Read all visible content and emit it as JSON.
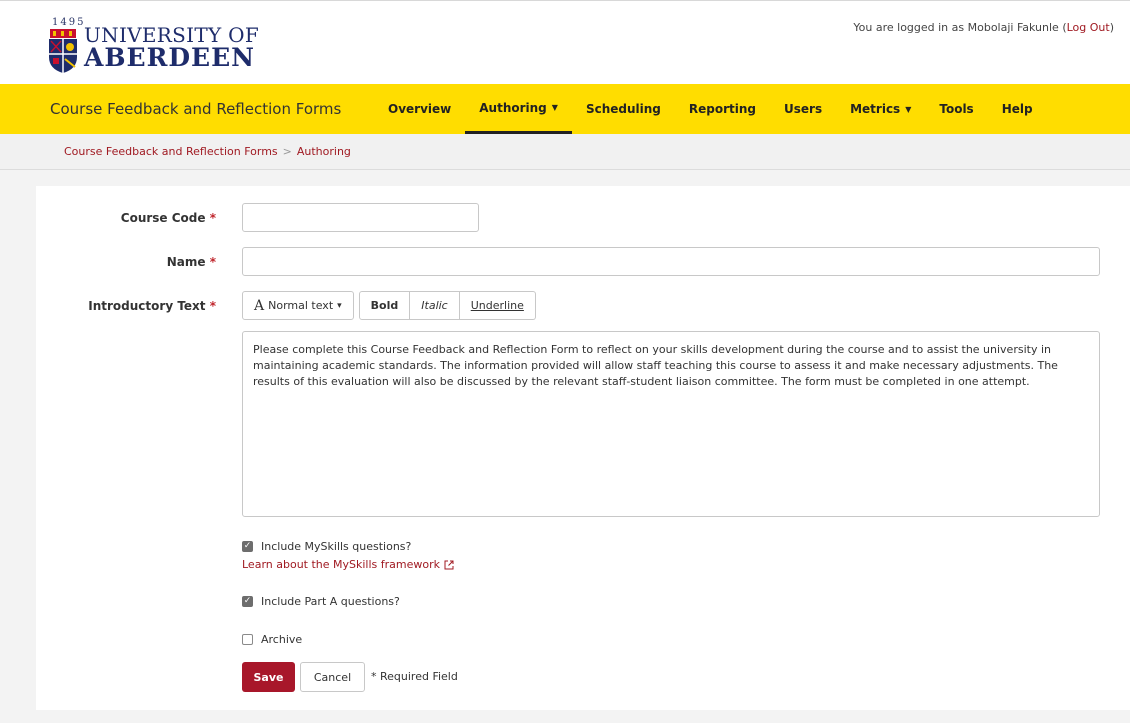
{
  "header": {
    "logo": {
      "year": "1495",
      "line1": "UNIVERSITY OF",
      "line2": "ABERDEEN"
    },
    "login_text": "You are logged in as Mobolaji Fakunle (",
    "logout_label": "Log Out",
    "login_close": ")"
  },
  "navbar": {
    "brand": "Course Feedback and Reflection Forms",
    "items": [
      {
        "label": "Overview",
        "dropdown": false
      },
      {
        "label": "Authoring",
        "dropdown": true,
        "active": true
      },
      {
        "label": "Scheduling",
        "dropdown": false
      },
      {
        "label": "Reporting",
        "dropdown": false
      },
      {
        "label": "Users",
        "dropdown": false
      },
      {
        "label": "Metrics",
        "dropdown": true
      },
      {
        "label": "Tools",
        "dropdown": false
      },
      {
        "label": "Help",
        "dropdown": false
      }
    ],
    "caret": "▼"
  },
  "breadcrumb": {
    "items": [
      "Course Feedback and Reflection Forms",
      "Authoring"
    ],
    "separator": ">"
  },
  "form": {
    "required_mark": "*",
    "course_code": {
      "label": "Course Code",
      "value": ""
    },
    "name": {
      "label": "Name",
      "value": ""
    },
    "intro": {
      "label": "Introductory Text",
      "toolbar": {
        "style_glyph": "A",
        "style_label": "Normal text",
        "caret": "▾",
        "bold": "Bold",
        "italic": "Italic",
        "underline": "Underline"
      },
      "text": "Please complete this Course Feedback and Reflection Form to reflect on your skills development during the course and to assist the university in maintaining academic standards. The information provided will allow staff teaching this course to assess it and make necessary adjustments. The results of this evaluation will also be discussed by the relevant staff-student liaison committee. The form must be completed in one attempt."
    },
    "myskills": {
      "label": "Include MySkills questions?",
      "checked": true
    },
    "learn_link": "Learn about the MySkills framework",
    "part_a": {
      "label": "Include Part A questions?",
      "checked": true
    },
    "archive": {
      "label": "Archive",
      "checked": false
    },
    "save_label": "Save",
    "cancel_label": "Cancel",
    "required_note": "* Required Field"
  },
  "colors": {
    "navbar_bg": "#ffdd00",
    "accent_red": "#a8172a",
    "link_red": "#a01a22",
    "logo_blue": "#1e2c6b"
  }
}
